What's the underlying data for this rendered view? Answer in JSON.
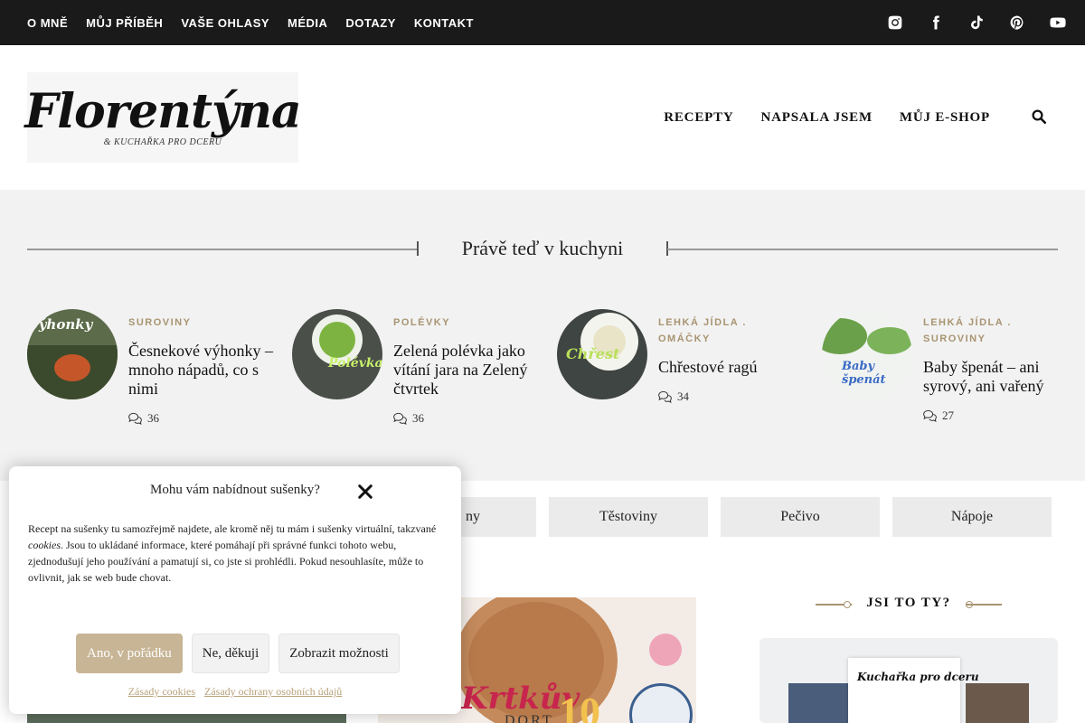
{
  "topnav": {
    "items": [
      "O MNĚ",
      "MŮJ PŘÍBĚH",
      "VAŠE OHLASY",
      "MÉDIA",
      "DOTAZY",
      "KONTAKT"
    ],
    "social_icons": [
      "instagram-icon",
      "facebook-icon",
      "tiktok-icon",
      "pinterest-icon",
      "youtube-icon"
    ]
  },
  "header": {
    "logo_text": "Florentýna",
    "logo_sub": "& KUCHAŘKA PRO DCERU",
    "nav": [
      "RECEPTY",
      "NAPSALA JSEM",
      "MŮJ E-SHOP"
    ],
    "search_icon": "search-icon"
  },
  "section": {
    "title": "Právě teď v kuchyni"
  },
  "posts": [
    {
      "category": "SUROVINY",
      "title": "Česnekové výhonky – mnoho nápadů, co s nimi",
      "comments": "36",
      "thumb_text": "výhonky"
    },
    {
      "category": "POLÉVKY",
      "title": "Zelená polévka jako vítání jara na Zelený čtvrtek",
      "comments": "36",
      "thumb_text": "Polévka"
    },
    {
      "category": "LEHKÁ JÍDLA . OMÁČKY",
      "title": "Chřestové ragú",
      "comments": "34",
      "thumb_text": "Chřest"
    },
    {
      "category": "LEHKÁ JÍDLA . SUROVINY",
      "title": "Baby špenát – ani syrový, ani vařený",
      "comments": "27",
      "thumb_text": "Baby špenát"
    }
  ],
  "categories": [
    "Těstoviny",
    "Těstoviny",
    "Pečivo",
    "Nápoje"
  ],
  "categories_visible": [
    "ny",
    "Těstoviny",
    "Pečivo",
    "Nápoje"
  ],
  "promo": {
    "text": "Krtkův",
    "sub": "DORT",
    "num": "10"
  },
  "jsi": {
    "title": "JSI TO TY?",
    "book_title": "Kuchařka pro dceru"
  },
  "cookie": {
    "title": "Mohu vám nabídnout sušenky?",
    "text_1": "Recept na sušenky tu samozřejmě najdete, ale kromě něj tu mám i sušenky virtuální, takzvané ",
    "text_em": "cookies",
    "text_2": ". Jsou to ukládané informace, které pomáhají při správné funkci tohoto webu, zjednodušují jeho používání a pamatují si, co jste si prohlédli. Pokud nesouhlasíte, může to ovlivnit, jak se web bude chovat.",
    "btn_accept": "Ano, v pořádku",
    "btn_deny": "Ne, děkuji",
    "btn_options": "Zobrazit možnosti",
    "link_cookies": "Zásady cookies",
    "link_privacy": "Zásady ochrany osobních údajů"
  },
  "colors": {
    "accent": "#a89471",
    "button_primary": "#c7b596",
    "topbar": "#1a1a1a"
  }
}
